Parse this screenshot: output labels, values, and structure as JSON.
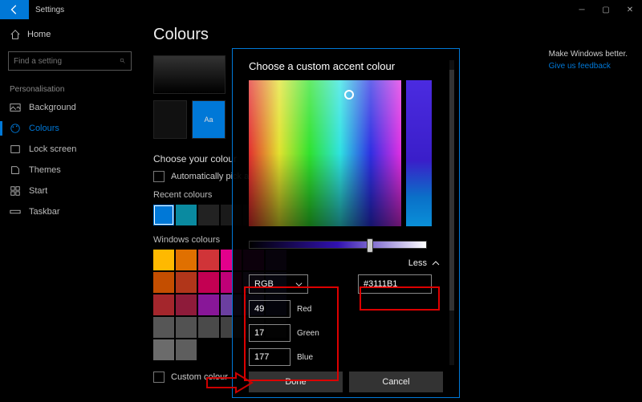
{
  "titlebar": {
    "title": "Settings"
  },
  "sidebar": {
    "home": "Home",
    "search_placeholder": "Find a setting",
    "group": "Personalisation",
    "items": [
      {
        "label": "Background"
      },
      {
        "label": "Colours"
      },
      {
        "label": "Lock screen"
      },
      {
        "label": "Themes"
      },
      {
        "label": "Start"
      },
      {
        "label": "Taskbar"
      }
    ]
  },
  "page": {
    "title": "Colours",
    "preview_aa": "Aa",
    "choose_heading": "Choose your colour",
    "auto_pick": "Automatically pick an accent colour from my background",
    "recent_label": "Recent colours",
    "recent_colours": [
      "#0078d7",
      "#0a8aa0",
      "#222222",
      "#1a1a1a",
      "#1a1a1a"
    ],
    "windows_label": "Windows colours",
    "palette": [
      "#ffb900",
      "#e07000",
      "#d03438",
      "#e3008c",
      "#9a0089",
      "#5c2e91",
      "#c44e00",
      "#b1361a",
      "#c30052",
      "#bf0077",
      "#744da9",
      "#4f4bb0",
      "#a4262c",
      "#8e1b3a",
      "#881798",
      "#6b3fa0",
      "#5a4ebc",
      "#3b3a8f",
      "#565656",
      "#525252",
      "#4a4a4a",
      "#424242",
      "#3b3b3b",
      "#2e2e2e",
      "#6b6b6b",
      "#5e5e5e"
    ],
    "custom_label": "Custom colour"
  },
  "feedback": {
    "heading": "Make Windows better.",
    "link": "Give us feedback"
  },
  "dialog": {
    "heading": "Choose a custom accent colour",
    "less": "Less",
    "mode": "RGB",
    "red": {
      "value": "49",
      "label": "Red"
    },
    "green": {
      "value": "17",
      "label": "Green"
    },
    "blue": {
      "value": "177",
      "label": "Blue"
    },
    "hex": "#3111B1",
    "done": "Done",
    "cancel": "Cancel"
  }
}
